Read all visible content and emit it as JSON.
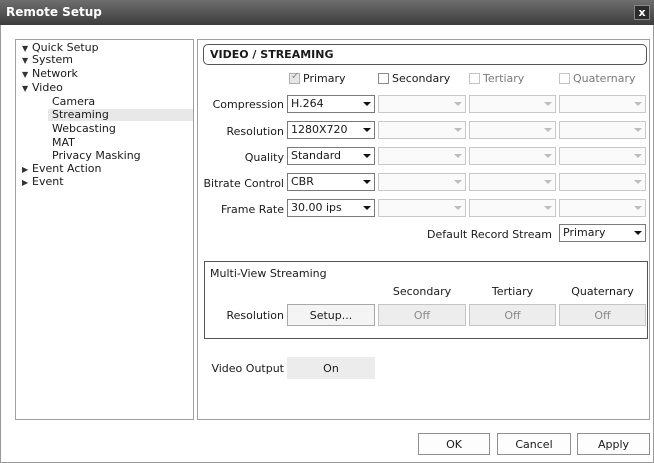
{
  "window": {
    "title": "Remote Setup",
    "close_glyph": "x"
  },
  "tree": [
    {
      "label": "Quick Setup",
      "arrow": "▼"
    },
    {
      "label": "System",
      "arrow": "▼"
    },
    {
      "label": "Network",
      "arrow": "▼"
    },
    {
      "label": "Video",
      "arrow": "▼"
    },
    {
      "label": "Camera",
      "arrow": ""
    },
    {
      "label": "Streaming",
      "arrow": "",
      "selected": true
    },
    {
      "label": "Webcasting",
      "arrow": ""
    },
    {
      "label": "MAT",
      "arrow": ""
    },
    {
      "label": "Privacy Masking",
      "arrow": ""
    },
    {
      "label": "Event Action",
      "arrow": "▶"
    },
    {
      "label": "Event",
      "arrow": "▶"
    }
  ],
  "section_title": "VIDEO / STREAMING",
  "streams": [
    {
      "label": "Primary",
      "checked": true,
      "enabled": false
    },
    {
      "label": "Secondary",
      "checked": false,
      "enabled": true
    },
    {
      "label": "Tertiary",
      "checked": false,
      "enabled": false
    },
    {
      "label": "Quaternary",
      "checked": false,
      "enabled": false
    }
  ],
  "rows": [
    {
      "label": "Compression",
      "primary_value": "H.264"
    },
    {
      "label": "Resolution",
      "primary_value": "1280X720"
    },
    {
      "label": "Quality",
      "primary_value": "Standard"
    },
    {
      "label": "Bitrate Control",
      "primary_value": "CBR"
    },
    {
      "label": "Frame Rate",
      "primary_value": "30.00 ips"
    }
  ],
  "default_record": {
    "label": "Default Record Stream",
    "value": "Primary"
  },
  "multiview": {
    "title": "Multi-View Streaming",
    "columns": [
      "Secondary",
      "Tertiary",
      "Quaternary"
    ],
    "row_label": "Resolution",
    "setup_label": "Setup...",
    "values": [
      "Off",
      "Off",
      "Off"
    ]
  },
  "video_output": {
    "label": "Video Output",
    "value": "On"
  },
  "buttons": {
    "ok": "OK",
    "cancel": "Cancel",
    "apply": "Apply"
  }
}
